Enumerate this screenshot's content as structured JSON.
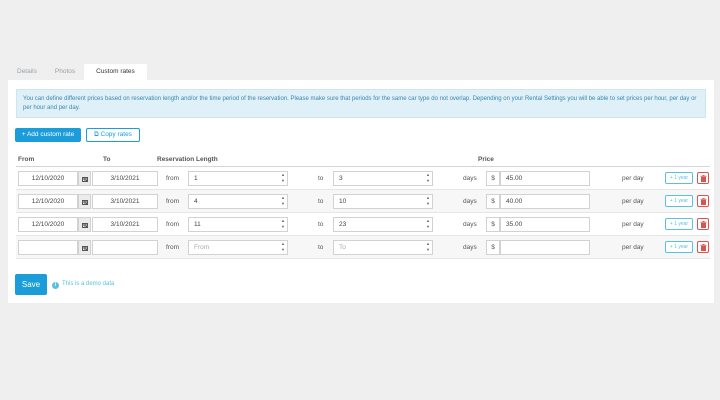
{
  "tabs": [
    {
      "label": "Details",
      "active": false
    },
    {
      "label": "Photos",
      "active": false
    },
    {
      "label": "Custom rates",
      "active": true
    }
  ],
  "info_text": "You can define different prices based on reservation length and/or the time period of the reservation. Please make sure that periods for the same car type do not overlap. Depending on your Rental Settings you will be able to set prices per hour, per day or per hour and per day.",
  "toolbar": {
    "add_label": "+ Add custom rate",
    "copy_label": "Copy rates"
  },
  "table": {
    "headers": {
      "from": "From",
      "to": "To",
      "length": "Reservation Length",
      "price": "Price"
    },
    "from_label": "from",
    "to_label": "to",
    "days_label": "days",
    "currency": "$",
    "per_day_label": "per day",
    "year_label": "+ 1 year",
    "rows": [
      {
        "from_date": "12/10/2020",
        "to_date": "3/10/2021",
        "len_from": "1",
        "len_to": "3",
        "price": "45.00"
      },
      {
        "from_date": "12/10/2020",
        "to_date": "3/10/2021",
        "len_from": "4",
        "len_to": "10",
        "price": "40.00"
      },
      {
        "from_date": "12/10/2020",
        "to_date": "3/10/2021",
        "len_from": "11",
        "len_to": "23",
        "price": "35.00"
      },
      {
        "from_date": "",
        "to_date": "",
        "len_from": "",
        "len_to": "",
        "price": ""
      }
    ],
    "placeholders": {
      "len_from": "From",
      "len_to": "To"
    }
  },
  "save_label": "Save",
  "demo_note": "This is a demo data",
  "colors": {
    "primary": "#1a9dd9",
    "info": "#5bc0de",
    "danger": "#d9534f",
    "info_bg": "#dff0f8"
  }
}
